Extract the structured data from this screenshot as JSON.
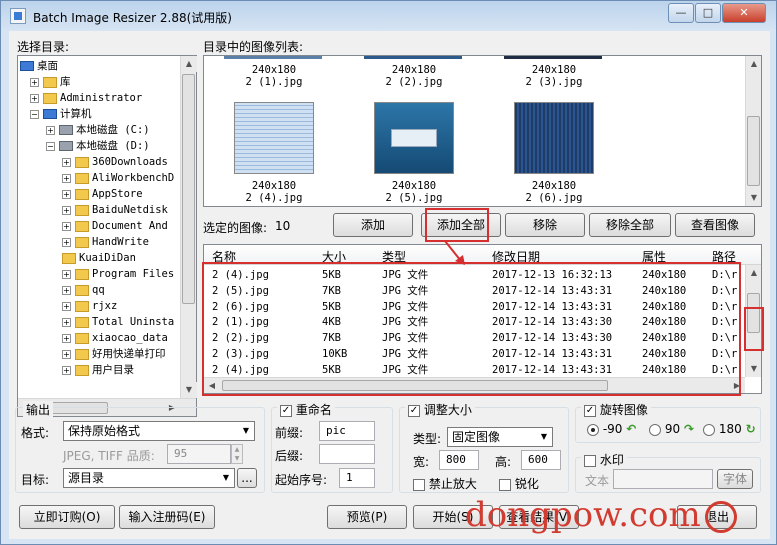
{
  "window": {
    "title": "Batch Image Resizer 2.88(试用版)",
    "min": "—",
    "max": "□",
    "close": "✕"
  },
  "left": {
    "label": "选择目录:",
    "tree": [
      {
        "label": "桌面",
        "icon": "desktop"
      },
      {
        "label": "库",
        "icon": "folder"
      },
      {
        "label": "Administrator",
        "icon": "folder"
      },
      {
        "label": "计算机",
        "icon": "computer"
      },
      {
        "label": "本地磁盘 (C:)",
        "icon": "drive"
      },
      {
        "label": "本地磁盘 (D:)",
        "icon": "drive"
      },
      {
        "label": "360Downloads",
        "icon": "folder"
      },
      {
        "label": "AliWorkbenchD",
        "icon": "folder"
      },
      {
        "label": "AppStore",
        "icon": "folder"
      },
      {
        "label": "BaiduNetdisk",
        "icon": "folder"
      },
      {
        "label": "Document And",
        "icon": "folder"
      },
      {
        "label": "HandWrite",
        "icon": "folder"
      },
      {
        "label": "KuaiDiDan",
        "icon": "folder"
      },
      {
        "label": "Program Files",
        "icon": "folder"
      },
      {
        "label": "qq",
        "icon": "folder"
      },
      {
        "label": "rjxz",
        "icon": "folder"
      },
      {
        "label": "Total Uninsta",
        "icon": "folder"
      },
      {
        "label": "xiaocao_data",
        "icon": "folder"
      },
      {
        "label": "好用快递单打印",
        "icon": "folder"
      },
      {
        "label": "用户目录",
        "icon": "folder"
      }
    ]
  },
  "images": {
    "label": "目录中的图像列表:",
    "items": [
      {
        "size": "240x180",
        "name": "2 (1).jpg"
      },
      {
        "size": "240x180",
        "name": "2 (2).jpg"
      },
      {
        "size": "240x180",
        "name": "2 (3).jpg"
      },
      {
        "size": "240x180",
        "name": "2 (4).jpg"
      },
      {
        "size": "240x180",
        "name": "2 (5).jpg"
      },
      {
        "size": "240x180",
        "name": "2 (6).jpg"
      }
    ]
  },
  "selected": {
    "label": "选定的图像:",
    "count": "10"
  },
  "buttons": {
    "add": "添加",
    "add_all": "添加全部",
    "remove": "移除",
    "remove_all": "移除全部",
    "view": "查看图像"
  },
  "list": {
    "columns": [
      "名称",
      "大小",
      "类型",
      "修改日期",
      "属性",
      "路径"
    ],
    "rows": [
      [
        "2 (4).jpg",
        "5KB",
        "JPG 文件",
        "2017-12-13 16:32:13",
        "240x180",
        "D:\\r"
      ],
      [
        "2 (5).jpg",
        "7KB",
        "JPG 文件",
        "2017-12-14 13:43:31",
        "240x180",
        "D:\\r"
      ],
      [
        "2 (6).jpg",
        "5KB",
        "JPG 文件",
        "2017-12-14 13:43:31",
        "240x180",
        "D:\\r"
      ],
      [
        "2 (1).jpg",
        "4KB",
        "JPG 文件",
        "2017-12-14 13:43:30",
        "240x180",
        "D:\\r"
      ],
      [
        "2 (2).jpg",
        "7KB",
        "JPG 文件",
        "2017-12-14 13:43:30",
        "240x180",
        "D:\\r"
      ],
      [
        "2 (3).jpg",
        "10KB",
        "JPG 文件",
        "2017-12-14 13:43:31",
        "240x180",
        "D:\\r"
      ],
      [
        "2 (4).jpg",
        "5KB",
        "JPG 文件",
        "2017-12-14 13:43:31",
        "240x180",
        "D:\\r"
      ]
    ]
  },
  "output": {
    "label": "输出",
    "format_label": "格式:",
    "format_value": "保持原始格式",
    "quality_label": "JPEG, TIFF 品质:",
    "quality_value": "95",
    "target_label": "目标:",
    "target_value": "源目录",
    "browse": "..."
  },
  "rename": {
    "label": "重命名",
    "prefix_label": "前缀:",
    "prefix_value": "pic",
    "suffix_label": "后缀:",
    "suffix_value": "",
    "start_label": "起始序号:",
    "start_value": "1"
  },
  "resize": {
    "label": "调整大小",
    "type_label": "类型:",
    "type_value": "固定图像",
    "width_label": "宽:",
    "width_value": "800",
    "height_label": "高:",
    "height_value": "600",
    "no_enlarge": "禁止放大",
    "sharpen": "锐化"
  },
  "rotate": {
    "label": "旋转图像",
    "options": [
      "-90",
      "90",
      "180"
    ]
  },
  "watermark": {
    "label": "水印",
    "text_label": "文本",
    "font_btn": "字体"
  },
  "bottom": {
    "order": "立即订购(O)",
    "register": "输入注册码(E)",
    "preview": "预览(P)",
    "start": "开始(S)",
    "view_result": "查看结果(V)",
    "exit": "退出"
  },
  "overlay": {
    "watermark_text": "dongpow.com"
  }
}
